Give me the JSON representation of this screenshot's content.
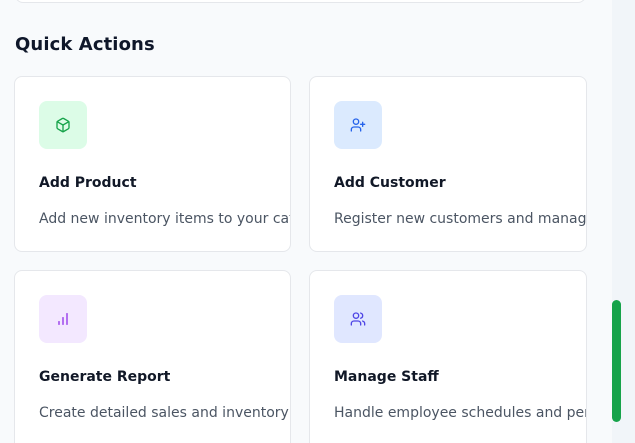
{
  "section": {
    "title": "Quick Actions"
  },
  "actions": [
    {
      "title": "Add Product",
      "description": "Add new inventory items to your catalog",
      "icon": "package-icon",
      "icon_color": "#16a34a",
      "icon_bg": "#dcfce7"
    },
    {
      "title": "Add Customer",
      "description": "Register new customers and manage profiles",
      "icon": "user-plus-icon",
      "icon_color": "#2563eb",
      "icon_bg": "#dbeafe"
    },
    {
      "title": "Generate Report",
      "description": "Create detailed sales and inventory reports",
      "icon": "bar-chart-icon",
      "icon_color": "#9333ea",
      "icon_bg": "#f3e8ff"
    },
    {
      "title": "Manage Staff",
      "description": "Handle employee schedules and permissions",
      "icon": "users-icon",
      "icon_color": "#4f46e5",
      "icon_bg": "#e0e7ff"
    }
  ],
  "colors": {
    "scrollbar_thumb": "#16a34a"
  }
}
